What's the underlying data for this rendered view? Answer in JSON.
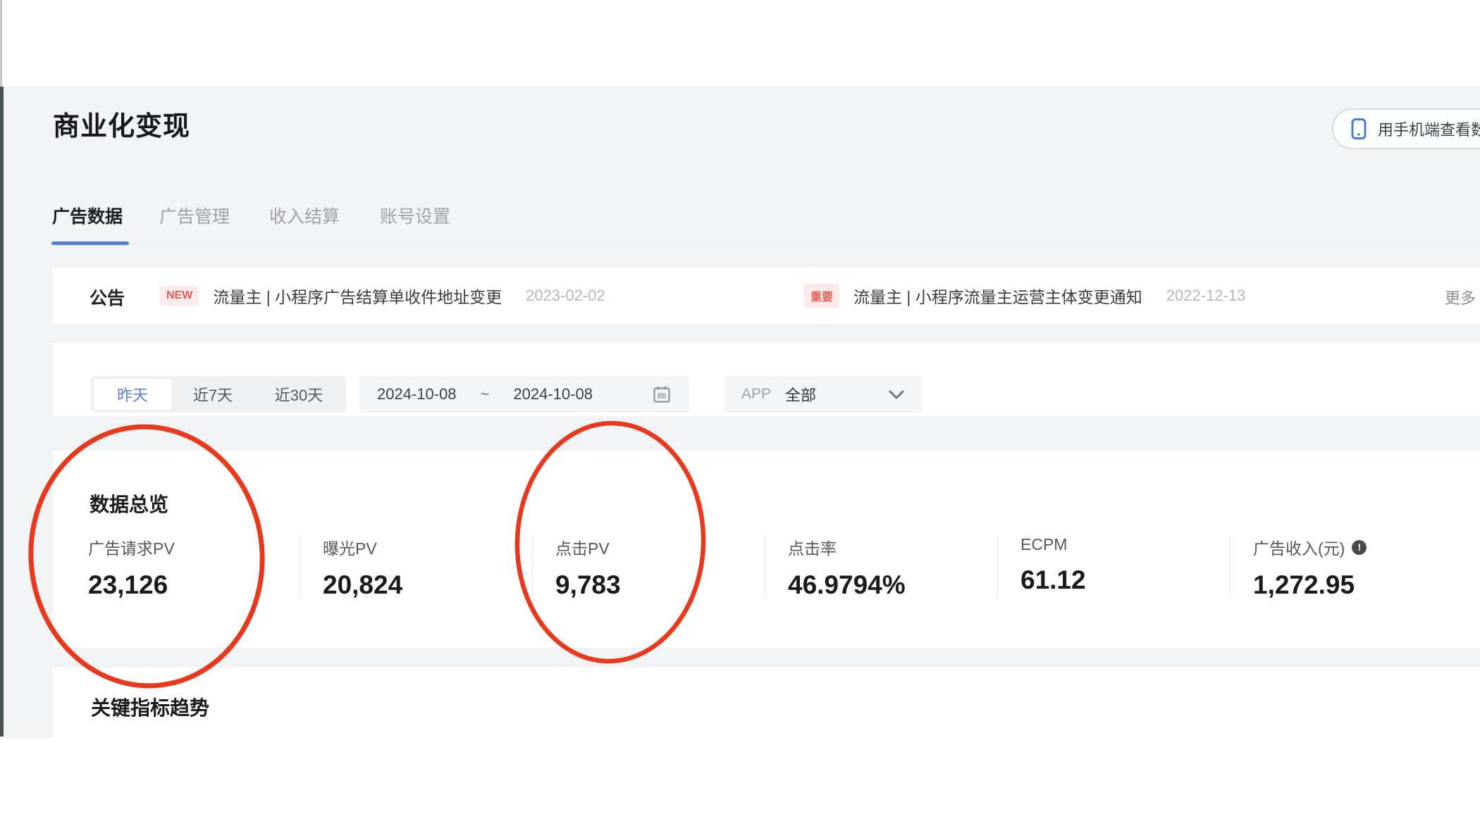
{
  "colors": {
    "accent-blue": "#5b7fd9",
    "annotation-red": "#e8391d",
    "badge-red-text": "#e45c59",
    "badge-red-bg": "#fcebe9",
    "page-bg": "#f2f3f5",
    "card-bg": "#ffffff"
  },
  "page": {
    "title": "商业化变现"
  },
  "header": {
    "mobile_view_button": "用手机端查看数"
  },
  "tabs": [
    {
      "label": "广告数据",
      "active": true
    },
    {
      "label": "广告管理",
      "active": false
    },
    {
      "label": "收入结算",
      "active": false
    },
    {
      "label": "账号设置",
      "active": false
    }
  ],
  "announcements": {
    "label": "公告",
    "more": "更多",
    "items": [
      {
        "badge": "NEW",
        "text": "流量主 | 小程序广告结算单收件地址变更",
        "date": "2023-02-02"
      },
      {
        "badge": "重要",
        "text": "流量主 | 小程序流量主运营主体变更通知",
        "date": "2022-12-13"
      }
    ]
  },
  "filters": {
    "quick": [
      {
        "label": "昨天",
        "selected": true
      },
      {
        "label": "近7天",
        "selected": false
      },
      {
        "label": "近30天",
        "selected": false
      }
    ],
    "date_start": "2024-10-08",
    "date_separator": "~",
    "date_end": "2024-10-08",
    "app_label": "APP",
    "app_value": "全部"
  },
  "overview": {
    "title": "数据总览",
    "metrics": [
      {
        "label": "广告请求PV",
        "value": "23,126",
        "circled": true
      },
      {
        "label": "曝光PV",
        "value": "20,824",
        "circled": false
      },
      {
        "label": "点击PV",
        "value": "9,783",
        "circled": true
      },
      {
        "label": "点击率",
        "value": "46.9794%",
        "circled": false
      },
      {
        "label": "ECPM",
        "value": "61.12",
        "circled": false
      },
      {
        "label": "广告收入(元)",
        "value": "1,272.95",
        "circled": false,
        "has_info_icon": true
      }
    ]
  },
  "trend": {
    "title": "关键指标趋势"
  }
}
